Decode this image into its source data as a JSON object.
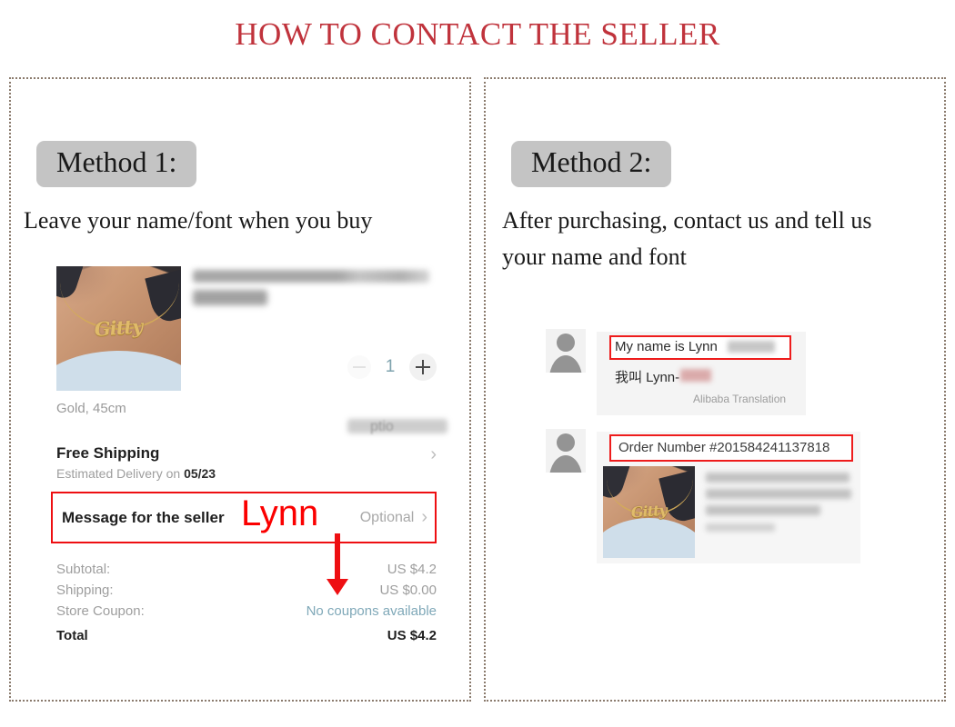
{
  "title": "HOW TO CONTACT THE SELLER",
  "colors": {
    "title_red": "#c0333c",
    "annotation_red": "#ee0f12",
    "badge_gray": "#c4c4c4",
    "link_teal": "#7fa8b8",
    "dotted_border": "#8a7a6c"
  },
  "methods": [
    {
      "badge": "Method 1:",
      "description": "Leave your name/font when you buy"
    },
    {
      "badge": "Method 2:",
      "description": "After purchasing, contact us and tell us your name and font"
    }
  ],
  "cart": {
    "product_image_pendant": "Gitty",
    "product_title_blurred": "Personalized Name Necklace, Cu...",
    "product_price_blurred": "US $4.2",
    "quantity": {
      "minus_label": "−",
      "value": "1",
      "plus_label": "+"
    },
    "variant": "Gold, 45cm",
    "option_blurred": "ptio",
    "shipping": {
      "title": "Free Shipping",
      "estimate_prefix": "Estimated Delivery on ",
      "estimate_date": "05/23",
      "chevron": "›"
    },
    "message_row": {
      "label": "Message for the seller",
      "value": "Optional",
      "chevron": "›"
    },
    "totals": [
      {
        "label": "Subtotal:",
        "value": "US $4.2",
        "style": "normal"
      },
      {
        "label": "Shipping:",
        "value": "US $0.00",
        "style": "normal"
      },
      {
        "label": "Store Coupon:",
        "value": "No coupons available",
        "style": "coupon"
      },
      {
        "label": "Total",
        "value": "US $4.2",
        "style": "grand"
      }
    ],
    "annotation": {
      "text": "Lynn",
      "arrow": "down-arrow"
    }
  },
  "chat": {
    "messages": [
      {
        "sender_avatar": "user-avatar",
        "text_en": "My name is Lynn",
        "text_cn": "我叫 Lynn-",
        "translation_note": "Alibaba Translation"
      },
      {
        "sender_avatar": "user-avatar",
        "order_number": "Order Number #201584241137818",
        "thumb_pendant": "Gitty"
      }
    ]
  }
}
